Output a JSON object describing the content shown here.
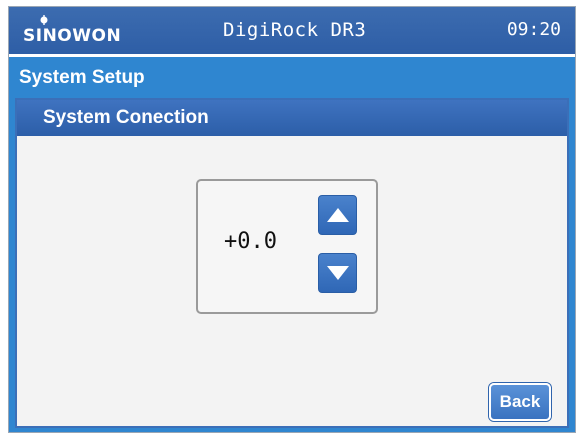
{
  "header": {
    "brand": "SINOWON",
    "product": "DigiRock DR3",
    "time": "09:20"
  },
  "screen": {
    "title": "System Setup",
    "panel_title": "System Conection"
  },
  "stepper": {
    "value": "+0.0",
    "up_icon": "triangle-up-icon",
    "down_icon": "triangle-down-icon"
  },
  "actions": {
    "back_label": "Back"
  },
  "colors": {
    "header_blue": "#2e5ea6",
    "frame_blue": "#2f86d0",
    "panel_bg": "#f3f3f3",
    "button_blue": "#3a73c0"
  }
}
